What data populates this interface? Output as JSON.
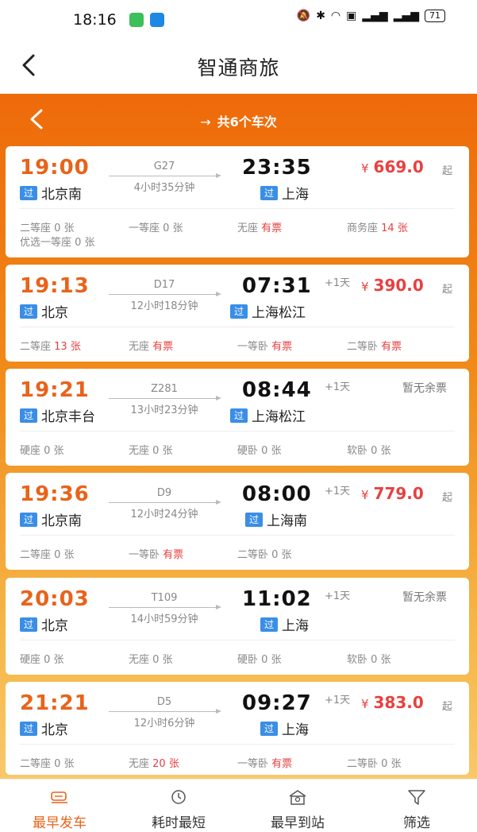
{
  "status_bar": {
    "time": "18:16",
    "icons": [
      "mute-icon",
      "bluetooth-icon",
      "wifi-icon",
      "hd-icon",
      "5g-signal-icon",
      "4g-signal-icon"
    ],
    "battery": "71"
  },
  "nav": {
    "title": "智通商旅"
  },
  "sub_header": {
    "arrow": "→",
    "title": "共6个车次"
  },
  "colors": {
    "accent": "#e8631a",
    "price": "#e84040",
    "tag": "#3a8ee6"
  },
  "trains": [
    {
      "dep_time": "19:00",
      "train_no": "G27",
      "duration": "4小时35分钟",
      "arr_time": "23:35",
      "dep_tag": "过",
      "dep_station": "北京南",
      "arr_tag": "过",
      "arr_station": "上海",
      "plus_day": "",
      "price_symbol": "¥",
      "price": "669.0",
      "price_suffix": "起",
      "no_ticket": "",
      "seats": [
        {
          "name": "二等座",
          "value": "0 张",
          "highlight": false
        },
        {
          "name": "一等座",
          "value": "0 张",
          "highlight": false
        },
        {
          "name": "无座",
          "value": "有票",
          "highlight": true
        },
        {
          "name": "商务座",
          "value": "14 张",
          "highlight": true
        },
        {
          "name": "优选一等座",
          "value": "0 张",
          "highlight": false
        }
      ]
    },
    {
      "dep_time": "19:13",
      "train_no": "D17",
      "duration": "12小时18分钟",
      "arr_time": "07:31",
      "dep_tag": "过",
      "dep_station": "北京",
      "arr_tag": "过",
      "arr_station": "上海松江",
      "plus_day": "+1天",
      "price_symbol": "¥",
      "price": "390.0",
      "price_suffix": "起",
      "no_ticket": "",
      "seats": [
        {
          "name": "二等座",
          "value": "13 张",
          "highlight": true
        },
        {
          "name": "无座",
          "value": "有票",
          "highlight": true
        },
        {
          "name": "一等卧",
          "value": "有票",
          "highlight": true
        },
        {
          "name": "二等卧",
          "value": "有票",
          "highlight": true
        }
      ]
    },
    {
      "dep_time": "19:21",
      "train_no": "Z281",
      "duration": "13小时23分钟",
      "arr_time": "08:44",
      "dep_tag": "过",
      "dep_station": "北京丰台",
      "arr_tag": "过",
      "arr_station": "上海松江",
      "plus_day": "+1天",
      "price_symbol": "",
      "price": "",
      "price_suffix": "",
      "no_ticket": "暂无余票",
      "seats": [
        {
          "name": "硬座",
          "value": "0 张",
          "highlight": false
        },
        {
          "name": "无座",
          "value": "0 张",
          "highlight": false
        },
        {
          "name": "硬卧",
          "value": "0 张",
          "highlight": false
        },
        {
          "name": "软卧",
          "value": "0 张",
          "highlight": false
        }
      ]
    },
    {
      "dep_time": "19:36",
      "train_no": "D9",
      "duration": "12小时24分钟",
      "arr_time": "08:00",
      "dep_tag": "过",
      "dep_station": "北京南",
      "arr_tag": "过",
      "arr_station": "上海南",
      "plus_day": "+1天",
      "price_symbol": "¥",
      "price": "779.0",
      "price_suffix": "起",
      "no_ticket": "",
      "seats": [
        {
          "name": "二等座",
          "value": "0 张",
          "highlight": false
        },
        {
          "name": "一等卧",
          "value": "有票",
          "highlight": true
        },
        {
          "name": "二等卧",
          "value": "0 张",
          "highlight": false
        }
      ]
    },
    {
      "dep_time": "20:03",
      "train_no": "T109",
      "duration": "14小时59分钟",
      "arr_time": "11:02",
      "dep_tag": "过",
      "dep_station": "北京",
      "arr_tag": "过",
      "arr_station": "上海",
      "plus_day": "+1天",
      "price_symbol": "",
      "price": "",
      "price_suffix": "",
      "no_ticket": "暂无余票",
      "seats": [
        {
          "name": "硬座",
          "value": "0 张",
          "highlight": false
        },
        {
          "name": "无座",
          "value": "0 张",
          "highlight": false
        },
        {
          "name": "硬卧",
          "value": "0 张",
          "highlight": false
        },
        {
          "name": "软卧",
          "value": "0 张",
          "highlight": false
        }
      ]
    },
    {
      "dep_time": "21:21",
      "train_no": "D5",
      "duration": "12小时6分钟",
      "arr_time": "09:27",
      "dep_tag": "过",
      "dep_station": "北京",
      "arr_tag": "过",
      "arr_station": "上海",
      "plus_day": "+1天",
      "price_symbol": "¥",
      "price": "383.0",
      "price_suffix": "起",
      "no_ticket": "",
      "seats": [
        {
          "name": "二等座",
          "value": "0 张",
          "highlight": false
        },
        {
          "name": "无座",
          "value": "20 张",
          "highlight": true
        },
        {
          "name": "一等卧",
          "value": "有票",
          "highlight": true
        },
        {
          "name": "二等卧",
          "value": "0 张",
          "highlight": false
        }
      ]
    }
  ],
  "tabs": [
    {
      "label": "最早发车",
      "icon": "train-icon",
      "active": true
    },
    {
      "label": "耗时最短",
      "icon": "clock-icon",
      "active": false
    },
    {
      "label": "最早到站",
      "icon": "station-icon",
      "active": false
    },
    {
      "label": "筛选",
      "icon": "filter-icon",
      "active": false
    }
  ]
}
